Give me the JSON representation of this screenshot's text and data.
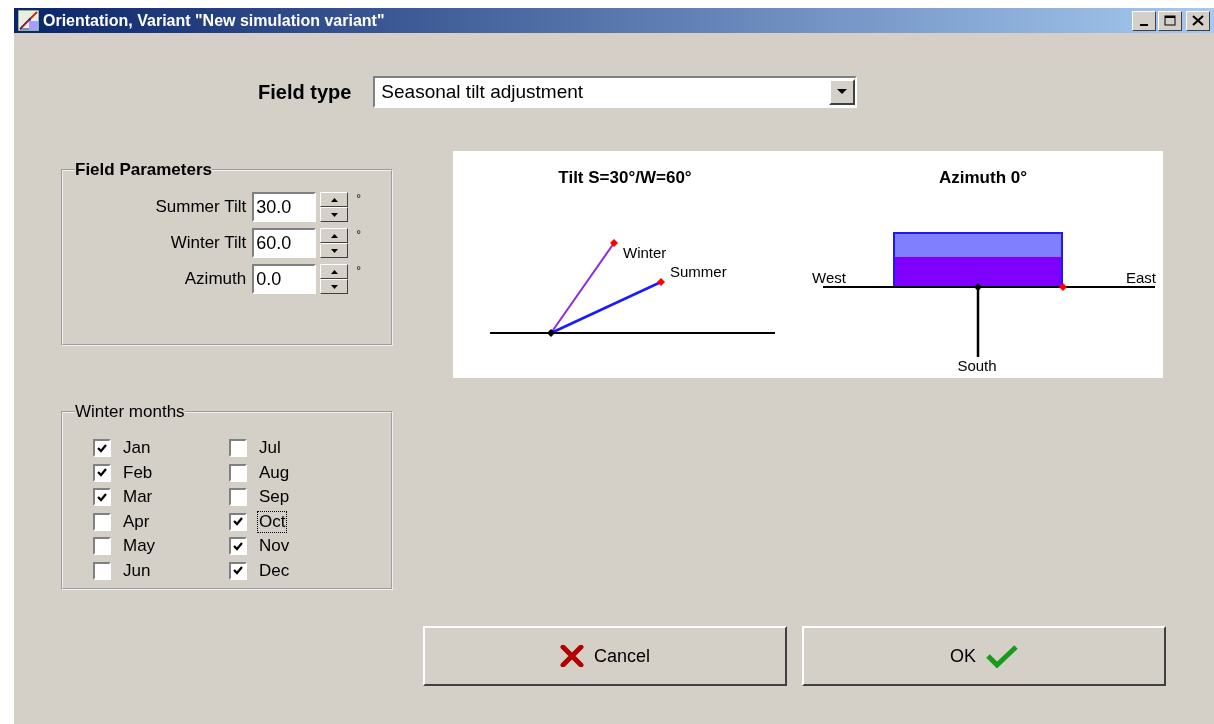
{
  "window": {
    "title": "Orientation, Variant \"New simulation variant\""
  },
  "field_type": {
    "label": "Field type",
    "value": "Seasonal tilt adjustment"
  },
  "field_parameters": {
    "title": "Field Parameters",
    "params": [
      {
        "label": "Summer Tilt",
        "value": "30.0",
        "unit": "°"
      },
      {
        "label": "Winter Tilt",
        "value": "60.0",
        "unit": "°"
      },
      {
        "label": "Azimuth",
        "value": "0.0",
        "unit": "°"
      }
    ]
  },
  "diagram": {
    "tilt_title": "Tilt S=30°/W=60°",
    "winter_label": "Winter",
    "summer_label": "Summer",
    "azimuth_title": "Azimuth 0°",
    "west_label": "West",
    "east_label": "East",
    "south_label": "South"
  },
  "winter_months": {
    "title": "Winter months",
    "months": [
      {
        "label": "Jan",
        "checked": true,
        "focused": false
      },
      {
        "label": "Feb",
        "checked": true,
        "focused": false
      },
      {
        "label": "Mar",
        "checked": true,
        "focused": false
      },
      {
        "label": "Apr",
        "checked": false,
        "focused": false
      },
      {
        "label": "May",
        "checked": false,
        "focused": false
      },
      {
        "label": "Jun",
        "checked": false,
        "focused": false
      },
      {
        "label": "Jul",
        "checked": false,
        "focused": false
      },
      {
        "label": "Aug",
        "checked": false,
        "focused": false
      },
      {
        "label": "Sep",
        "checked": false,
        "focused": false
      },
      {
        "label": "Oct",
        "checked": true,
        "focused": true
      },
      {
        "label": "Nov",
        "checked": true,
        "focused": false
      },
      {
        "label": "Dec",
        "checked": true,
        "focused": false
      }
    ]
  },
  "buttons": [
    {
      "kind": "cancel",
      "label": "Cancel"
    },
    {
      "kind": "ok",
      "label": "OK"
    }
  ]
}
